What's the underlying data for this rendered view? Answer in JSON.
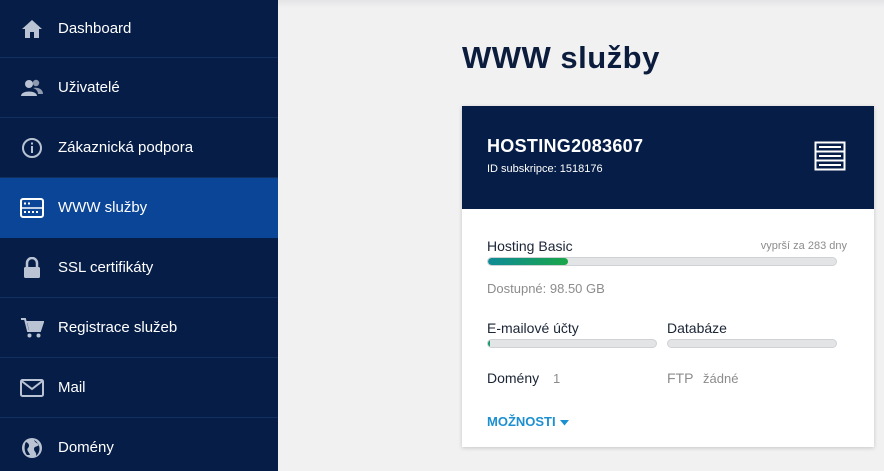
{
  "sidebar": {
    "items": [
      {
        "label": "Dashboard",
        "icon": "home-icon"
      },
      {
        "label": "Uživatelé",
        "icon": "users-icon"
      },
      {
        "label": "Zákaznická podpora",
        "icon": "info-icon"
      },
      {
        "label": "WWW služby",
        "icon": "server-icon",
        "active": true
      },
      {
        "label": "SSL certifikáty",
        "icon": "lock-icon"
      },
      {
        "label": "Registrace služeb",
        "icon": "cart-icon"
      },
      {
        "label": "Mail",
        "icon": "mail-icon"
      },
      {
        "label": "Domény",
        "icon": "globe-icon"
      }
    ]
  },
  "page": {
    "title": "WWW služby"
  },
  "card": {
    "title": "HOSTING2083607",
    "subscription_id": "ID subskripce: 1518176",
    "plan_name": "Hosting Basic",
    "expiry": "vyprší za 283 dny",
    "storage_used_fraction": 0.23,
    "available": "Dostupné: 98.50 GB",
    "email_label": "E-mailové účty",
    "email_used_fraction": 0.01,
    "db_label": "Databáze",
    "db_used_fraction": 0,
    "domains_label": "Domény",
    "domains_value": "1",
    "ftp_label": "FTP",
    "ftp_value": "žádné",
    "options_label": "MOŽNOSTI"
  },
  "colors": {
    "sidebar_bg": "#061e47",
    "sidebar_active": "#0b4597",
    "accent_link": "#1c8fd0",
    "progress_fill": "#1aa64a"
  }
}
